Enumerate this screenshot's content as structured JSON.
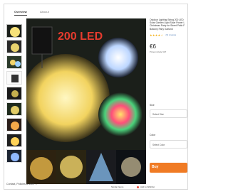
{
  "tabs": [
    {
      "label": "Overview"
    },
    {
      "label": "Abouut"
    }
  ],
  "product": {
    "title": "Outdoor Lighting String 200 LED Solar Garden Light Solar Power L Christmas Party for Street Patio F Balcony Fairy Garland",
    "rating_stars": "★★★★☆",
    "reviews": "(3) reviews",
    "price": "€6",
    "price_note": "Prices include VAT",
    "size_label": "Size",
    "size_placeholder": "Select Size",
    "color_label": "Color",
    "color_placeholder": "Select Color",
    "buy_label": "Buy"
  },
  "photo": {
    "banner_text": "200 LED",
    "banner_color": "#e63b2e"
  },
  "footer": {
    "left": "Contact, Policies & More ⌄",
    "btn_left": "Similar Items",
    "btn_right": "Add to Wishlist"
  },
  "colors": {
    "buy": "#f07b24",
    "stars": "#f2a900",
    "warm_led": "#f7e27a"
  }
}
